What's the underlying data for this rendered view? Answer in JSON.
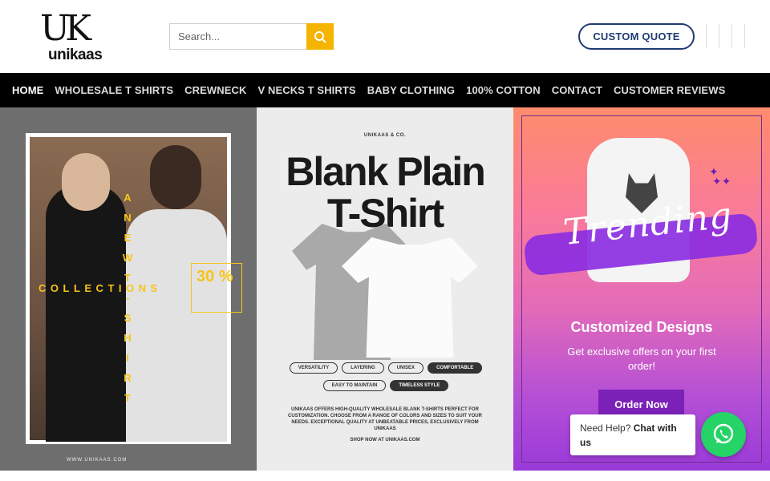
{
  "header": {
    "logo_mark": "UK",
    "logo_brand": "unikaas",
    "search_placeholder": "Search...",
    "custom_quote_label": "CUSTOM QUOTE"
  },
  "nav": {
    "items": [
      {
        "label": "HOME",
        "active": true
      },
      {
        "label": "WHOLESALE T SHIRTS"
      },
      {
        "label": "CREWNECK"
      },
      {
        "label": "V NECKS T SHIRTS"
      },
      {
        "label": "BABY CLOTHING"
      },
      {
        "label": "100% COTTON"
      },
      {
        "label": "CONTACT"
      },
      {
        "label": "CUSTOMER REVIEWS"
      }
    ]
  },
  "banner1": {
    "vertical_word": "A NEW T-SHIRT",
    "collections": "COLLECTIONS",
    "discount": "30 %",
    "url": "WWW.UNIKAAS.COM"
  },
  "banner2": {
    "brand": "UNIKAAS & CO.",
    "title_line1": "Blank Plain",
    "title_line2": "T-Shirt",
    "tags_row1": [
      "VERSATILITY",
      "LAYERING",
      "UNISEX",
      "COMFORTABLE"
    ],
    "tags_row2": [
      "EASY TO MAINTAIN",
      "TIMELESS STYLE"
    ],
    "description": "UNIKAAS OFFERS HIGH-QUALITY WHOLESALE BLANK T-SHIRTS PERFECT FOR CUSTOMIZATION. CHOOSE FROM A RANGE OF COLORS AND SIZES TO SUIT YOUR NEEDS. EXCEPTIONAL QUALITY AT UNBEATABLE PRICES, EXCLUSIVELY FROM UNIKAAS",
    "shop": "SHOP NOW AT UNIKAAS.COM"
  },
  "banner3": {
    "script_word": "Trending",
    "heading": "Customized Designs",
    "subtext": "Get exclusive offers on your first order!",
    "button": "Order Now"
  },
  "help": {
    "prefix": "Need Help?",
    "bold": "Chat with us"
  },
  "colors": {
    "accent_yellow": "#f4b400",
    "quote_blue": "#1f3b73",
    "nav_bg": "#000000",
    "whatsapp_green": "#25d366",
    "order_purple": "#7b21b7"
  }
}
